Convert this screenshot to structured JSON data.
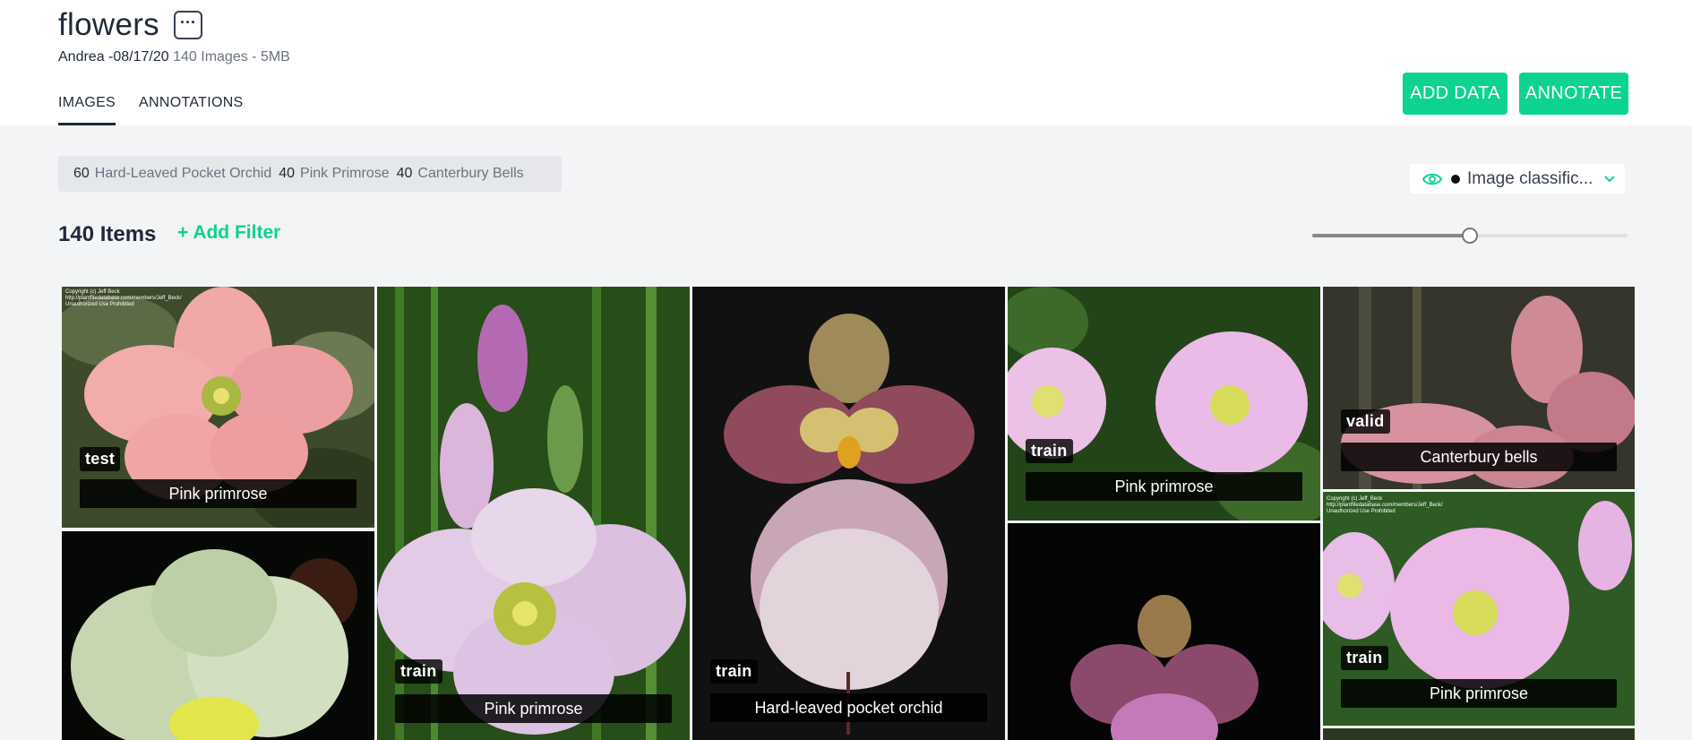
{
  "dataset": {
    "title": "flowers",
    "owner_date": "Andrea -08/17/20",
    "summary": "140 Images - 5MB"
  },
  "tabs": [
    {
      "label": "IMAGES",
      "active": true
    },
    {
      "label": "ANNOTATIONS",
      "active": false
    }
  ],
  "actions": {
    "add_data": "ADD DATA",
    "annotate": "ANNOTATE",
    "more_icon": "ellipsis-icon"
  },
  "class_counts": [
    {
      "count": "60",
      "label": "Hard-Leaved Pocket Orchid"
    },
    {
      "count": "40",
      "label": "Pink Primrose"
    },
    {
      "count": "40",
      "label": "Canterbury Bells"
    }
  ],
  "view_selector": {
    "value": "Image classific...",
    "icon": "eye-icon"
  },
  "toolbar": {
    "items_count": "140 Items",
    "add_filter": "+ Add Filter",
    "zoom_fraction": 0.5
  },
  "colors": {
    "accent": "#0cd38f",
    "text": "#1f2937"
  },
  "images": [
    {
      "split": "test",
      "label": "Pink primrose",
      "watermark": "Copyright (c) Jeff Beck\nhttp://plantfiledatabase.com/members/Jeff_Beck/\nUnauthorized Use Prohibited"
    },
    {
      "split": "",
      "label": ""
    },
    {
      "split": "train",
      "label": "Pink primrose"
    },
    {
      "split": "train",
      "label": "Hard-leaved pocket orchid"
    },
    {
      "split": "train",
      "label": "Pink primrose"
    },
    {
      "split": "",
      "label": ""
    },
    {
      "split": "valid",
      "label": "Canterbury bells"
    },
    {
      "split": "train",
      "label": "Pink primrose",
      "watermark": "Copyright (c) Jeff_Beck\nhttp://plantfiledatabase.com/members/Jeff_Beck/\nUnauthorized Use Prohibited"
    }
  ]
}
